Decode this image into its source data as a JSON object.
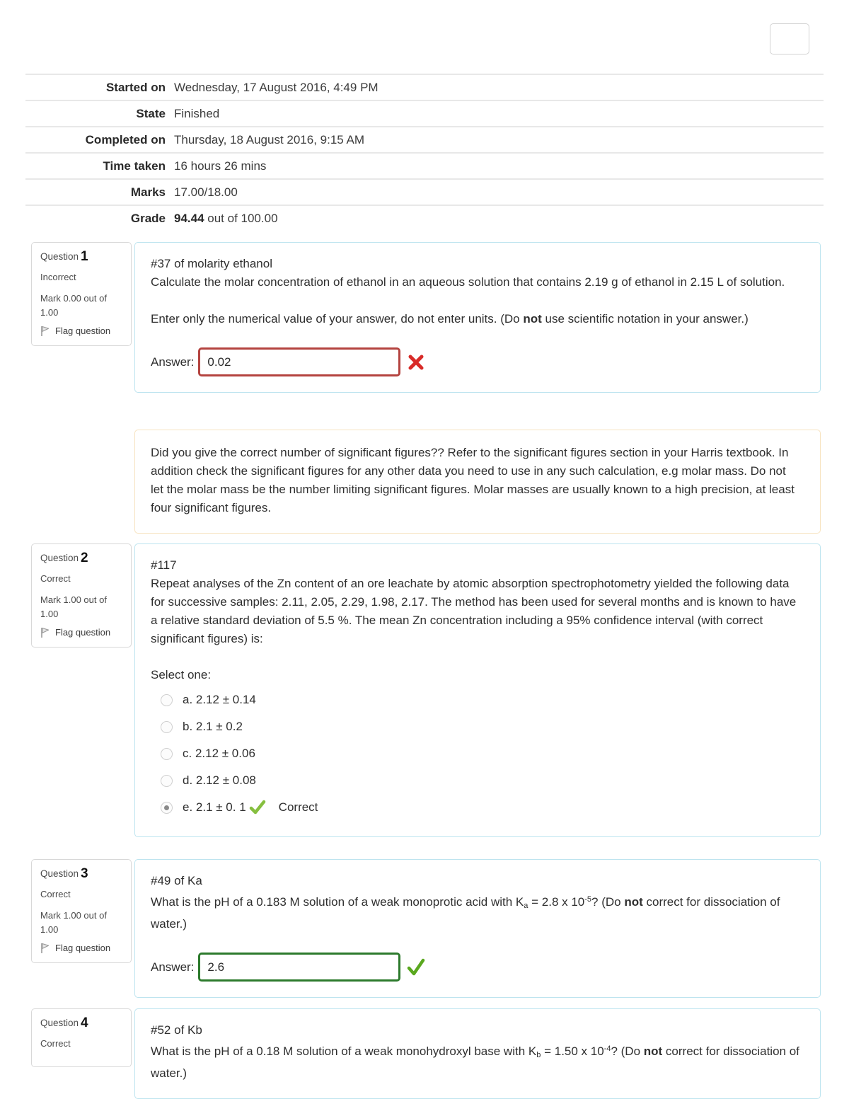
{
  "summary": {
    "rows": [
      {
        "label": "Started on",
        "value": "Wednesday, 17 August 2016, 4:49 PM"
      },
      {
        "label": "State",
        "value": "Finished"
      },
      {
        "label": "Completed on",
        "value": "Thursday, 18 August 2016, 9:15 AM"
      },
      {
        "label": "Time taken",
        "value": "16 hours 26 mins"
      },
      {
        "label": "Marks",
        "value": "17.00/18.00"
      },
      {
        "label": "Grade",
        "value_bold": "94.44",
        "value_rest": " out of 100.00"
      }
    ]
  },
  "labels": {
    "answer": "Answer:",
    "select_one": "Select one:",
    "flag_question": "Flag question"
  },
  "colors": {
    "question_border": "#bde4ef",
    "feedback_border": "#f7e3c0",
    "wrong_red": "#b4433f",
    "correct_green": "#2c7a2c",
    "tick_green": "#86bf3f",
    "separator": "#e8e8e8"
  },
  "questions": [
    {
      "number_label": "Question",
      "number": "1",
      "state": "Incorrect",
      "mark": "Mark 0.00 out of 1.00",
      "title": "#37 of molarity ethanol",
      "body": "Calculate the molar concentration of ethanol in an aqueous solution that contains 2.19 g of ethanol in 2.15 L of solution.",
      "instruction_pre": "Enter only the numerical value of your answer, do not enter units. (Do ",
      "instruction_bold": "not",
      "instruction_post": " use scientific notation in your answer.)",
      "answer_value": "0.02",
      "result": "incorrect"
    },
    {
      "number_label": "Question",
      "number": "2",
      "state": "Correct",
      "mark": "Mark 1.00 out of 1.00",
      "title": "#117",
      "body": "Repeat analyses of the Zn content of an ore leachate by atomic absorption spectrophotometry yielded the following data for successive samples: 2.11, 2.05, 2.29, 1.98, 2.17. The method has been used for several months and is known to have a relative standard deviation of 5.5 %. The mean Zn concentration including a 95% confidence interval (with correct significant figures) is:",
      "options": [
        {
          "text": "a. 2.12 ± 0.14",
          "selected": false,
          "feedback": ""
        },
        {
          "text": "b. 2.1 ± 0.2",
          "selected": false,
          "feedback": ""
        },
        {
          "text": "c. 2.12 ± 0.06",
          "selected": false,
          "feedback": ""
        },
        {
          "text": "d. 2.12 ± 0.08",
          "selected": false,
          "feedback": ""
        },
        {
          "text": "e. 2.1 ± 0. 1",
          "selected": true,
          "feedback": "Correct"
        }
      ]
    },
    {
      "number_label": "Question",
      "number": "3",
      "state": "Correct",
      "mark": "Mark 1.00 out of 1.00",
      "title": "#49 of Ka",
      "body_pre": "What is the pH of a 0.183 M solution of a weak monoprotic acid with K",
      "body_sub": "a",
      "body_mid": " = 2.8 x 10",
      "body_sup": "-5",
      "body_post1": "? (Do ",
      "body_bold": "not",
      "body_post2": " correct for dissociation of water.)",
      "answer_value": "2.6",
      "result": "correct"
    },
    {
      "number_label": "Question",
      "number": "4",
      "state": "Correct",
      "title": "#52 of Kb",
      "body_pre": "What is the pH of a 0.18 M solution of a weak monohydroxyl base with K",
      "body_sub": "b",
      "body_mid": " = 1.50 x 10",
      "body_sup": "-4",
      "body_post1": "? (Do ",
      "body_bold": "not",
      "body_post2": " correct for dissociation of water.)"
    }
  ],
  "feedback_q1": "Did you give the correct number of significant figures?? Refer to the significant figures section in your Harris textbook. In addition check the significant figures for any other data you need to use in any such calculation, e.g molar mass. Do not let the molar mass be the number limiting significant figures. Molar masses are usually known to a high precision, at least four significant figures."
}
